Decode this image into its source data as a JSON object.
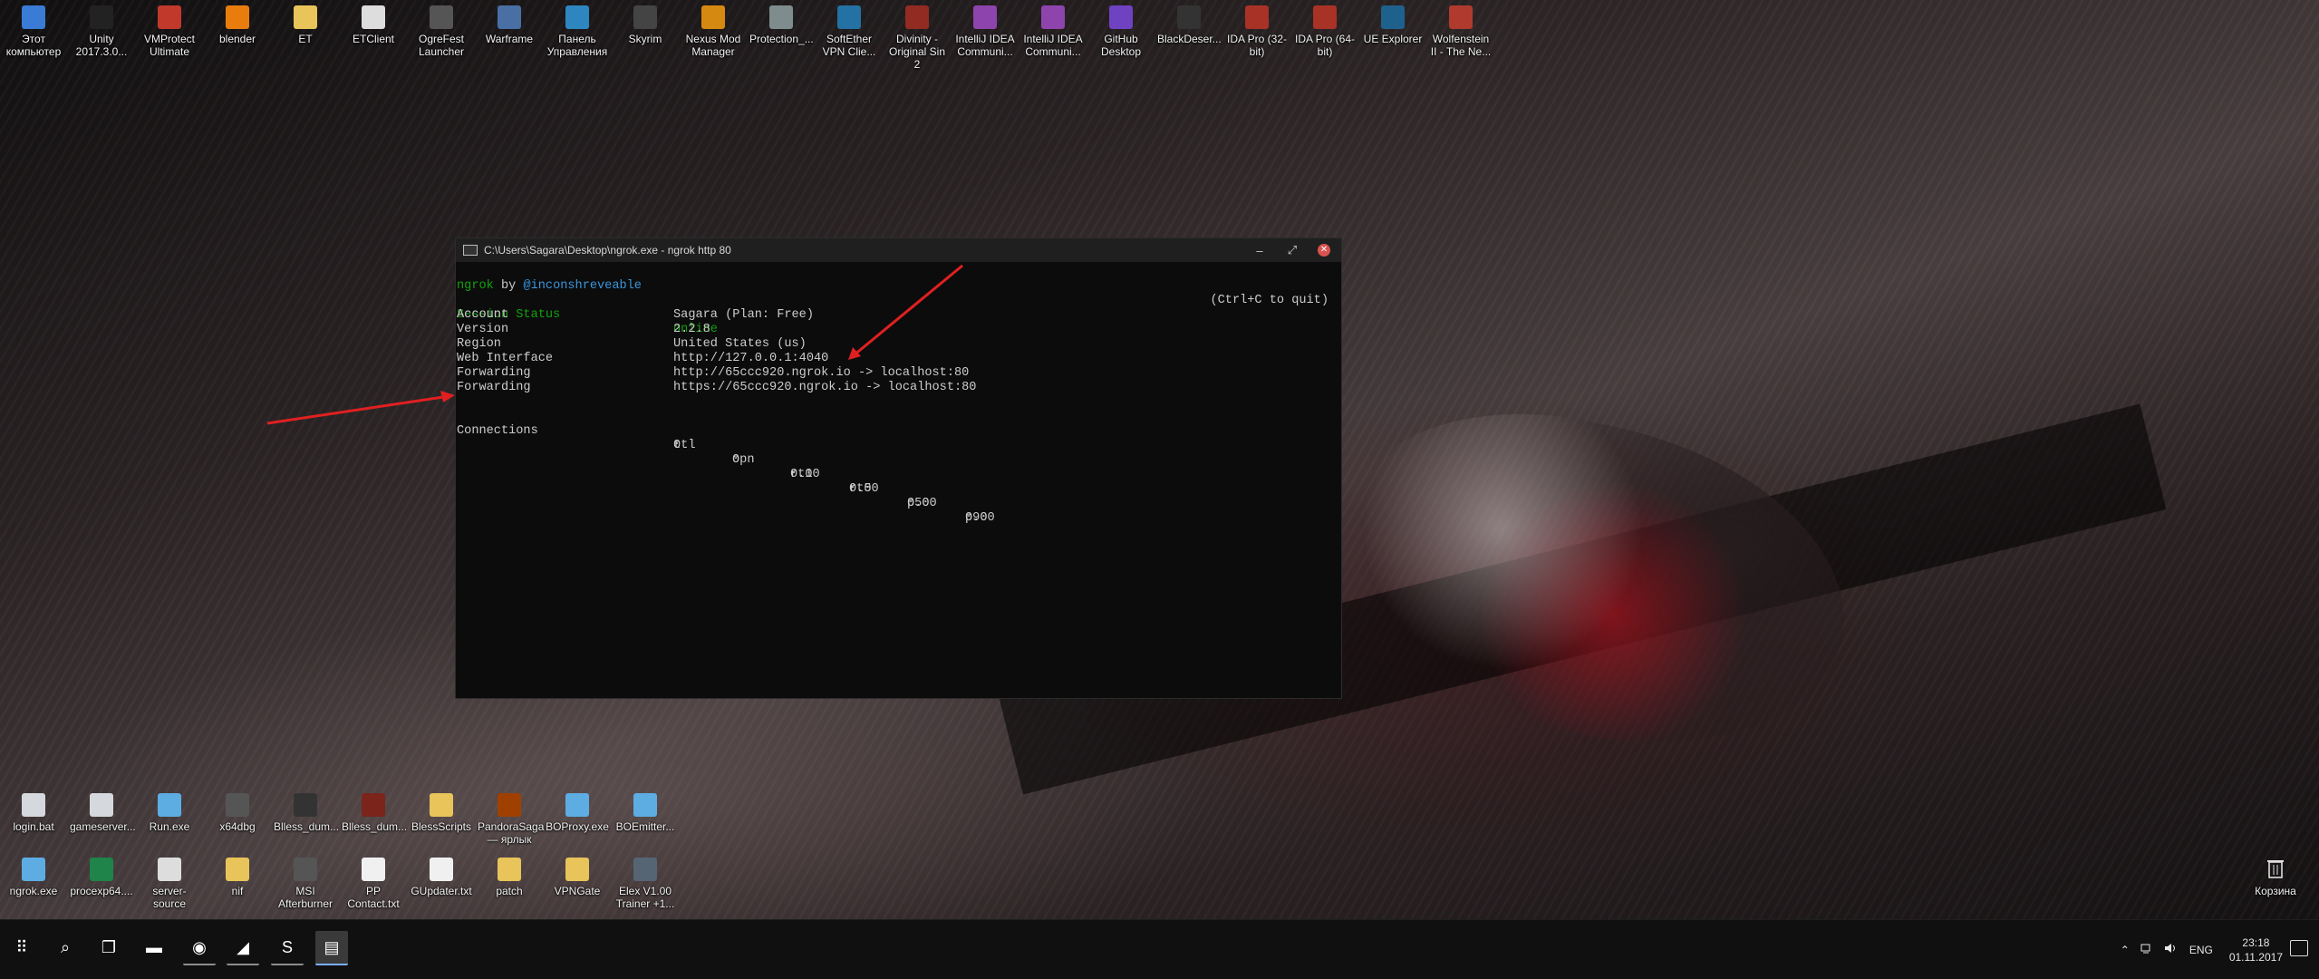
{
  "desktop_top_icons": [
    {
      "label": "Этот компьютер",
      "icon": "computer-icon",
      "color": "#3a7bd5"
    },
    {
      "label": "Unity 2017.3.0...",
      "icon": "unity-icon",
      "color": "#222222"
    },
    {
      "label": "VMProtect Ultimate",
      "icon": "vmprotect-icon",
      "color": "#c0392b"
    },
    {
      "label": "blender",
      "icon": "blender-icon",
      "color": "#e87d0d"
    },
    {
      "label": "ET",
      "icon": "folder-icon",
      "color": "#e8c45a"
    },
    {
      "label": "ETClient",
      "icon": "file-icon",
      "color": "#dddddd"
    },
    {
      "label": "OgreFest Launcher",
      "icon": "ogrefest-icon",
      "color": "#555555"
    },
    {
      "label": "Warframe",
      "icon": "warframe-icon",
      "color": "#4a6fa5"
    },
    {
      "label": "Панель Управления",
      "icon": "control-panel-icon",
      "color": "#2e86c1"
    },
    {
      "label": "Skyrim",
      "icon": "skyrim-icon",
      "color": "#444444"
    },
    {
      "label": "Nexus Mod Manager",
      "icon": "nexus-icon",
      "color": "#d68910"
    },
    {
      "label": "Protection_...",
      "icon": "protection-icon",
      "color": "#7f8c8d"
    },
    {
      "label": "SoftEther VPN Clie...",
      "icon": "vpn-icon",
      "color": "#2471a3"
    },
    {
      "label": "Divinity - Original Sin 2",
      "icon": "divinity-icon",
      "color": "#922b21"
    },
    {
      "label": "IntelliJ IDEA Communi...",
      "icon": "intellij-icon",
      "color": "#8e44ad"
    },
    {
      "label": "IntelliJ IDEA Communi...",
      "icon": "intellij-icon",
      "color": "#8e44ad"
    },
    {
      "label": "GitHub Desktop",
      "icon": "github-icon",
      "color": "#6f42c1"
    },
    {
      "label": "BlackDeser...",
      "icon": "blackdesert-icon",
      "color": "#333333"
    },
    {
      "label": "IDA Pro (32-bit)",
      "icon": "ida-icon",
      "color": "#a93226"
    },
    {
      "label": "IDA Pro (64-bit)",
      "icon": "ida-icon",
      "color": "#a93226"
    },
    {
      "label": "UE Explorer",
      "icon": "ue-explorer-icon",
      "color": "#1f618d"
    },
    {
      "label": "Wolfenstein II - The Ne...",
      "icon": "wolfenstein-icon",
      "color": "#b03a2e"
    }
  ],
  "desktop_bottom_row1": [
    {
      "label": "login.bat",
      "icon": "bat-file-icon",
      "color": "#d5d8dc"
    },
    {
      "label": "gameserver...",
      "icon": "bat-file-icon",
      "color": "#d5d8dc"
    },
    {
      "label": "Run.exe",
      "icon": "exe-icon",
      "color": "#5dade2"
    },
    {
      "label": "x64dbg",
      "icon": "debugger-icon",
      "color": "#555555"
    },
    {
      "label": "Blless_dum...",
      "icon": "bless-icon",
      "color": "#333333"
    },
    {
      "label": "Blless_dum...",
      "icon": "bless-icon",
      "color": "#7b241c"
    },
    {
      "label": "BlessScripts",
      "icon": "folder-icon",
      "color": "#e8c45a"
    },
    {
      "label": "PandoraSaga — ярлык",
      "icon": "pandora-icon",
      "color": "#a04000"
    },
    {
      "label": "BOProxy.exe",
      "icon": "exe-icon",
      "color": "#5dade2"
    },
    {
      "label": "BOEmitter...",
      "icon": "exe-icon",
      "color": "#5dade2"
    }
  ],
  "desktop_bottom_row2": [
    {
      "label": "ngrok.exe",
      "icon": "exe-icon",
      "color": "#5dade2"
    },
    {
      "label": "procexp64....",
      "icon": "procexp-icon",
      "color": "#1e8449"
    },
    {
      "label": "server-source",
      "icon": "file-icon",
      "color": "#dddddd"
    },
    {
      "label": "nif",
      "icon": "folder-icon",
      "color": "#e8c45a"
    },
    {
      "label": "MSI Afterburner",
      "icon": "afterburner-icon",
      "color": "#555555"
    },
    {
      "label": "PP Contact.txt",
      "icon": "text-file-icon",
      "color": "#f0f0f0"
    },
    {
      "label": "GUpdater.txt",
      "icon": "text-file-icon",
      "color": "#f0f0f0"
    },
    {
      "label": "patch",
      "icon": "folder-icon",
      "color": "#e8c45a"
    },
    {
      "label": "VPNGate",
      "icon": "folder-icon",
      "color": "#e8c45a"
    },
    {
      "label": "Elex V1.00 Trainer +1...",
      "icon": "trainer-icon",
      "color": "#566573"
    }
  ],
  "recycle_bin": {
    "label": "Корзина",
    "icon": "recycle-bin-icon"
  },
  "terminal": {
    "title": "C:\\Users\\Sagara\\Desktop\\ngrok.exe - ngrok  http 80",
    "minimize": "–",
    "maximize": "⤢",
    "close": "✕",
    "header_app": "ngrok",
    "header_by": " by ",
    "header_author": "@inconshreveable",
    "quit_hint": "(Ctrl+C to quit)",
    "session_status_label": "Session Status",
    "session_status_value": "online",
    "rows": [
      {
        "label": "Account",
        "value": "Sagara (Plan: Free)"
      },
      {
        "label": "Version",
        "value": "2.2.8"
      },
      {
        "label": "Region",
        "value": "United States (us)"
      },
      {
        "label": "Web Interface",
        "value": "http://127.0.0.1:4040"
      },
      {
        "label": "Forwarding",
        "value": "http://65ccc920.ngrok.io -> localhost:80"
      },
      {
        "label": "Forwarding",
        "value": "https://65ccc920.ngrok.io -> localhost:80"
      }
    ],
    "connections_label": "Connections",
    "metrics_headers": [
      "ttl",
      "opn",
      "rt1",
      "rt5",
      "p50",
      "p90"
    ],
    "metrics_values": [
      "0",
      "0",
      "0.00",
      "0.00",
      "0.00",
      "0.00"
    ]
  },
  "annotation_color": "#e02020",
  "taskbar": {
    "apps": [
      {
        "name": "start-button",
        "icon": "⠿"
      },
      {
        "name": "search-icon",
        "icon": "⌕"
      },
      {
        "name": "task-view-icon",
        "icon": "❐"
      },
      {
        "name": "file-explorer-icon",
        "icon": "▬"
      },
      {
        "name": "chrome-icon",
        "icon": "◉"
      },
      {
        "name": "game-launcher-icon",
        "icon": "◢"
      },
      {
        "name": "skype-icon",
        "icon": "S"
      },
      {
        "name": "console-icon",
        "icon": "▤"
      }
    ],
    "tray_chevron": "⌃",
    "language": "ENG",
    "time": "23:18",
    "date": "01.11.2017"
  }
}
